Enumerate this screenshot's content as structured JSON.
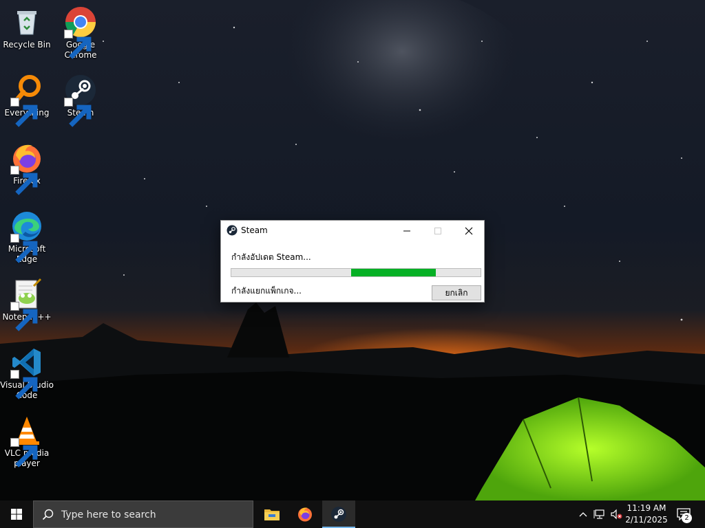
{
  "desktop": {
    "icons": [
      {
        "label": "Recycle Bin",
        "icon": "recycle-bin-icon"
      },
      {
        "label": "Google Chrome",
        "icon": "chrome-icon"
      },
      {
        "label": "Everything",
        "icon": "everything-icon"
      },
      {
        "label": "Steam",
        "icon": "steam-icon"
      },
      {
        "label": "Firefox",
        "icon": "firefox-icon"
      },
      {
        "label": "Microsoft Edge",
        "icon": "edge-icon"
      },
      {
        "label": "Notepad++",
        "icon": "notepadpp-icon"
      },
      {
        "label": "Visual Studio Code",
        "icon": "vscode-icon"
      },
      {
        "label": "VLC media player",
        "icon": "vlc-icon"
      }
    ]
  },
  "dialog": {
    "title": "Steam",
    "status_line_1": "กำลังอัปเดต Steam...",
    "status_line_2": "กำลังแยกแพ็กเกจ...",
    "cancel_label": "ยกเลิก",
    "progress": {
      "shown_segment_start": 0.48,
      "shown_segment_end": 0.82,
      "fill_color": "#06b025"
    }
  },
  "taskbar": {
    "search_placeholder": "Type here to search",
    "pinned": [
      "file-explorer-icon",
      "firefox-icon",
      "steam-icon"
    ],
    "active_app": "steam-icon",
    "time": "11:19 AM",
    "date": "2/11/2025",
    "notification_count": "2"
  },
  "colors": {
    "accent": "#76b9ed",
    "taskbar": "#101010",
    "progress_green": "#06b025"
  }
}
